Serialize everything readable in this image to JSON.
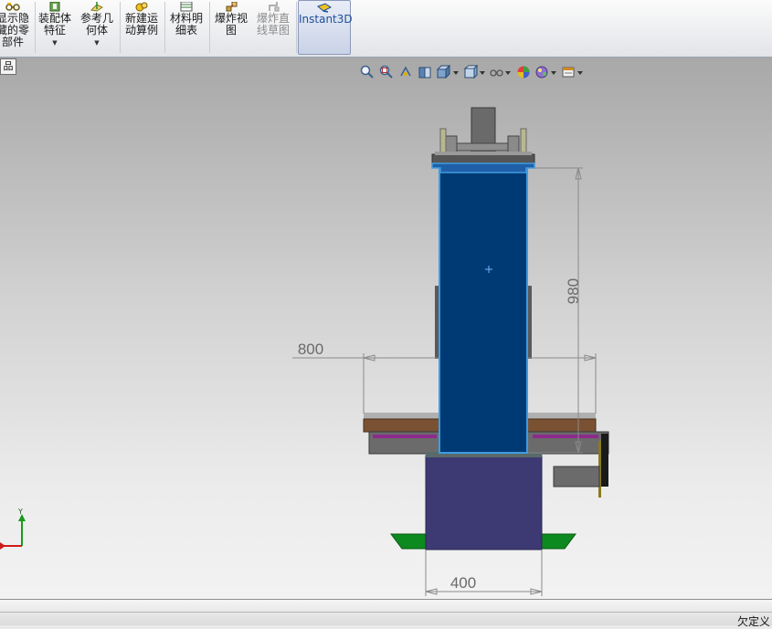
{
  "ribbon": {
    "buttons": [
      {
        "name": "show-hidden-components-button",
        "label1": "显示隐",
        "label2": "藏的零",
        "label3": "部件",
        "icon": "glasses-icon"
      },
      {
        "name": "assembly-features-button",
        "label1": "装配体",
        "label2": "特征",
        "icon": "assembly-feature-icon"
      },
      {
        "name": "reference-geometry-button",
        "label1": "参考几",
        "label2": "何体",
        "icon": "reference-geometry-icon"
      },
      {
        "name": "new-motion-study-button",
        "label1": "新建运",
        "label2": "动算例",
        "icon": "motion-study-icon"
      },
      {
        "name": "bill-of-materials-button",
        "label1": "材料明",
        "label2": "细表",
        "icon": "bom-icon"
      },
      {
        "name": "exploded-view-button",
        "label1": "爆炸视",
        "label2": "图",
        "icon": "explode-icon"
      },
      {
        "name": "explode-line-sketch-button",
        "label1": "爆炸直",
        "label2": "线草图",
        "icon": "explode-line-icon"
      },
      {
        "name": "instant3d-button",
        "label1": "Instant3D",
        "icon": "instant3d-icon"
      }
    ]
  },
  "tree_tab": {
    "label": "品"
  },
  "view_toolbar": {
    "icons": [
      "zoom-to-fit-icon",
      "zoom-to-area-icon",
      "previous-view-icon",
      "section-view-icon",
      "view-orientation-icon",
      "display-style-icon",
      "hide-show-items-icon",
      "edit-appearance-icon",
      "apply-scene-icon",
      "view-settings-icon"
    ]
  },
  "dimensions": {
    "width_800": "800",
    "height_980": "980",
    "base_400": "400"
  },
  "triad": {
    "y_label": "Y"
  },
  "colors": {
    "column_blue": "#003a75",
    "column_outline": "#3f9ce0",
    "base_block": "#3d3a73",
    "feet_green": "#0d8a1f",
    "platform_brown": "#7a5233",
    "purple_strip": "#8c2b8c"
  },
  "status": {
    "text": "欠定义"
  }
}
